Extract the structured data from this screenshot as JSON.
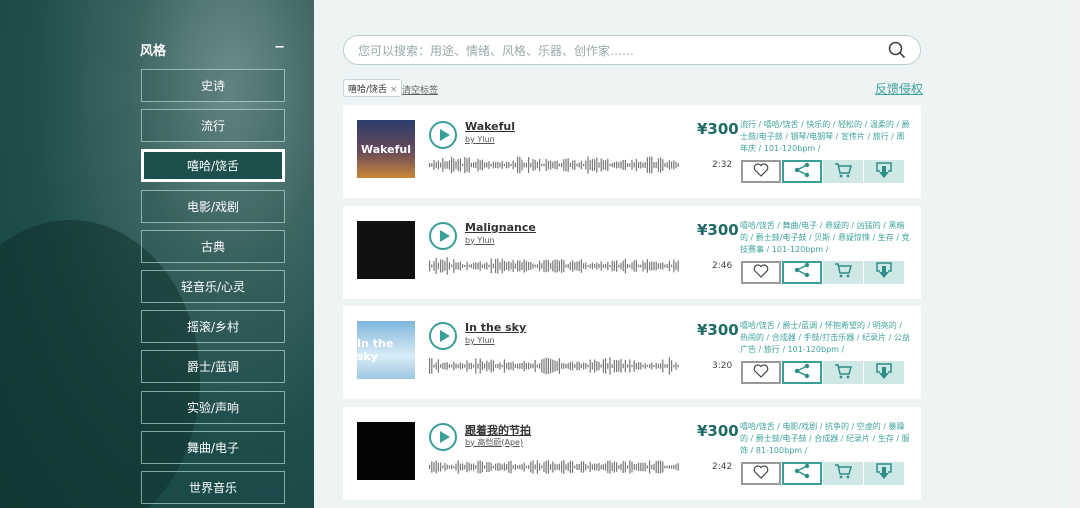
{
  "sidebar": {
    "heading": "风格",
    "collapse": "−",
    "genres": [
      "史诗",
      "流行",
      "嘻哈/饶舌",
      "电影/戏剧",
      "古典",
      "轻音乐/心灵",
      "摇滚/乡村",
      "爵士/蓝调",
      "实验/声响",
      "舞曲/电子",
      "世界音乐"
    ],
    "active": 2
  },
  "search": {
    "placeholder": "您可以搜索：用途、情绪、风格、乐器、创作家……"
  },
  "filters": {
    "tag": "嘻哈/饶舌",
    "tag_close": "×",
    "clear": "清空标签",
    "feedback": "反馈侵权"
  },
  "tracks": [
    {
      "title": "Wakeful",
      "artist": "by Ylun",
      "cover_text": "Wakeful",
      "duration": "2:32",
      "price": "¥300",
      "tags": "流行 / 嘻哈/饶舌 / 快乐的 / 轻松的 / 温柔的 / 爵士鼓/电子鼓 / 钢琴/电钢琴 / 宣传片 / 旅行 / 周年庆 / 101-120bpm /"
    },
    {
      "title": "Malignance",
      "artist": "by Ylun",
      "cover_text": "",
      "duration": "2:46",
      "price": "¥300",
      "tags": "嘻哈/饶舌 / 舞曲/电子 / 悬疑的 / 凶猛的 / 黑暗的 / 爵士鼓/电子鼓 / 贝斯 / 悬疑惊悚 / 生存 / 竞技赛事 / 101-120bpm /"
    },
    {
      "title": "In the sky",
      "artist": "by Ylun",
      "cover_text": "In the sky",
      "duration": "3:20",
      "price": "¥300",
      "tags": "嘻哈/饶舌 / 爵士/蓝调 / 怀抱希望的 / 明亮的 / 热闹的 / 合成器 / 手鼓/打击乐器 / 纪录片 / 公益广告 / 旅行 / 101-120bpm /"
    },
    {
      "title": "跟着我的节拍",
      "artist": "by 高恺蔚(Ape)",
      "cover_text": "",
      "duration": "2:42",
      "price": "¥300",
      "tags": "嘻哈/饶舌 / 电影/戏剧 / 抗争的 / 空虚的 / 暴躁的 / 爵士鼓/电子鼓 / 合成器 / 纪录片 / 生存 / 服饰 / 81-100bpm /"
    }
  ],
  "colors": {
    "accent": "#3a9f98",
    "price": "#1f6b66"
  }
}
